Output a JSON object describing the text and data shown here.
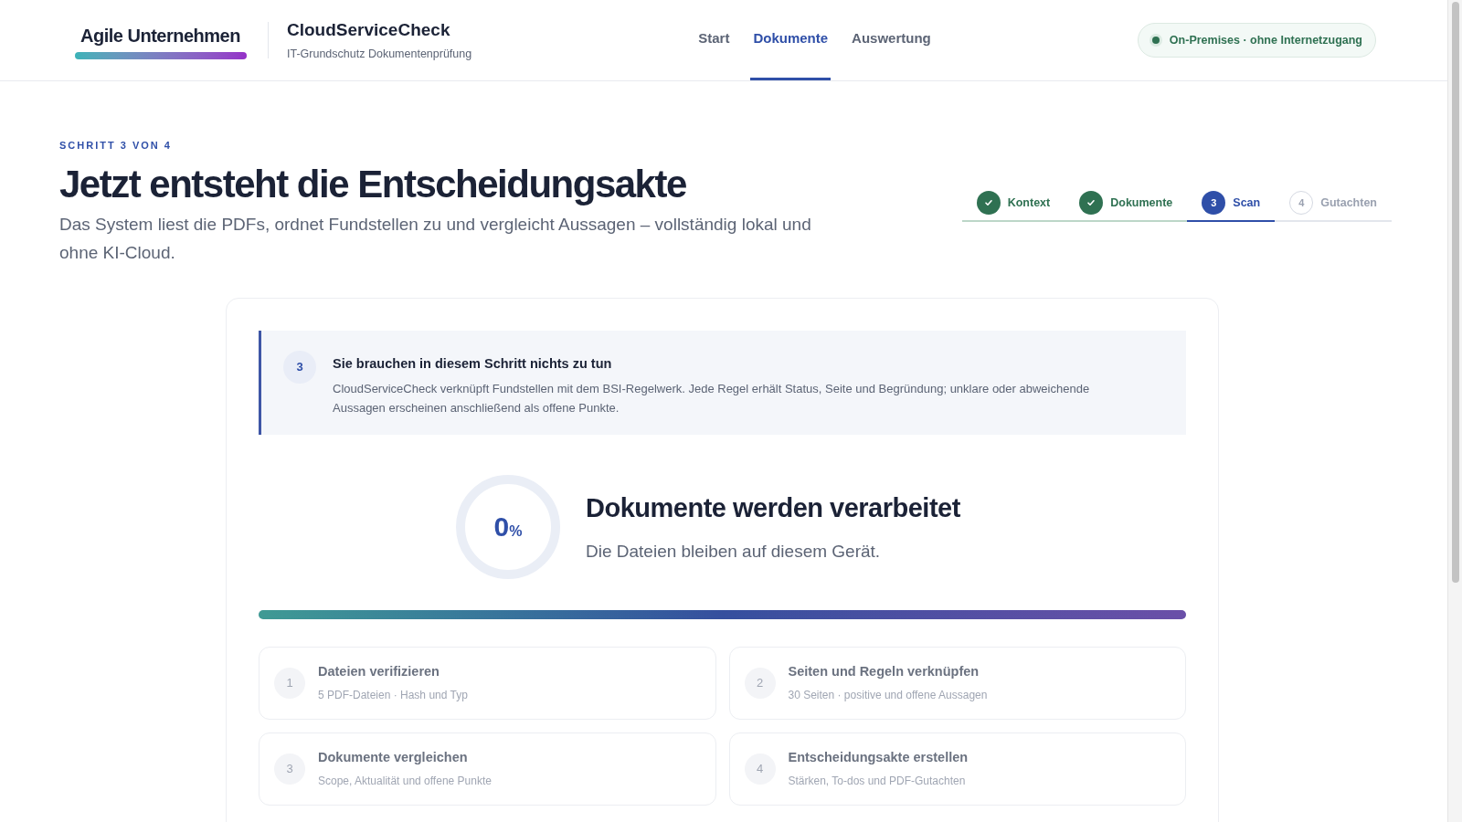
{
  "brand": {
    "name": "Agile Unternehmen"
  },
  "app": {
    "title": "CloudServiceCheck",
    "subtitle": "IT-Grundschutz Dokumentenprüfung"
  },
  "nav": [
    {
      "label": "Start",
      "selected": false
    },
    {
      "label": "Dokumente",
      "selected": true
    },
    {
      "label": "Auswertung",
      "selected": false
    }
  ],
  "status_badge": {
    "label": "On-Premises · ohne Internetzugang"
  },
  "page": {
    "eyebrow": "SCHRITT 3 VON 4",
    "title": "Jetzt entsteht die Entscheidungsakte",
    "lead": "Das System liest die PDFs, ordnet Fundstellen zu und vergleicht Aussagen – vollständig lokal und ohne KI-Cloud."
  },
  "stepper": [
    {
      "kind": "done",
      "label": "Kontext"
    },
    {
      "kind": "done",
      "label": "Dokumente"
    },
    {
      "kind": "current",
      "number": "3",
      "label": "Scan"
    },
    {
      "kind": "todo",
      "number": "4",
      "label": "Gutachten"
    }
  ],
  "notice": {
    "number": "3",
    "title": "Sie brauchen in diesem Schritt nichts zu tun",
    "text": "CloudServiceCheck verknüpft Fundstellen mit dem BSI-Regelwerk. Jede Regel erhält Status, Seite und Begründung; unklare oder abweichende Aussagen erscheinen anschließend als offene Punkte."
  },
  "progress": {
    "level": 1,
    "value": "0",
    "unit": "%",
    "title": "Dokumente werden verarbeitet",
    "subtitle": "Die Dateien bleiben auf diesem Gerät."
  },
  "tasks": [
    {
      "number": "1",
      "title": "Dateien verifizieren",
      "detail": "5 PDF-Dateien · Hash und Typ"
    },
    {
      "number": "2",
      "title": "Seiten und Regeln verknüpfen",
      "detail": "30 Seiten · positive und offene Aussagen"
    },
    {
      "number": "3",
      "title": "Dokumente vergleichen",
      "detail": "Scope, Aktualität und offene Punkte"
    },
    {
      "number": "4",
      "title": "Entscheidungsakte erstellen",
      "detail": "Stärken, To-dos und PDF-Gutachten"
    }
  ]
}
